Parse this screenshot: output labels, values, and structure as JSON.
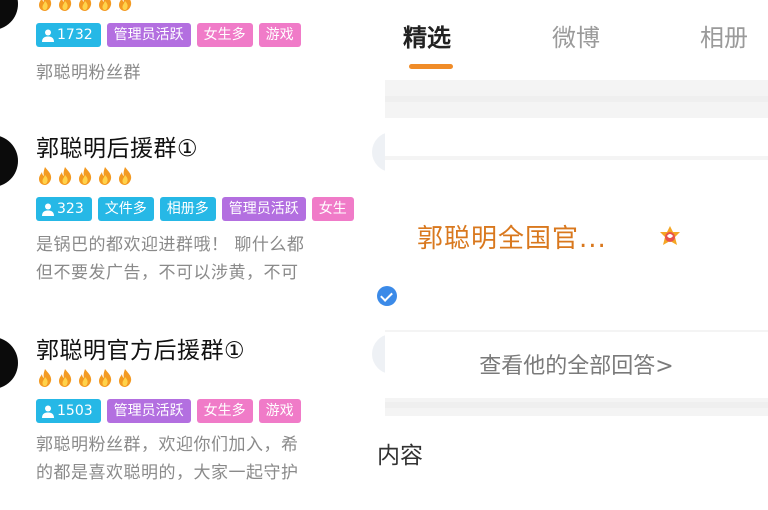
{
  "groups": [
    {
      "title": "",
      "flames": 5,
      "tags": [
        {
          "kind": "members",
          "text": "1732"
        },
        {
          "kind": "purple",
          "text": "管理员活跃"
        },
        {
          "kind": "pink",
          "text": "女生多"
        },
        {
          "kind": "pink",
          "text": "游戏"
        }
      ],
      "desc1": "郭聪明粉丝群",
      "desc2": ""
    },
    {
      "title": "郭聪明后援群①",
      "flames": 5,
      "tags": [
        {
          "kind": "members",
          "text": "323"
        },
        {
          "kind": "blue",
          "text": "文件多"
        },
        {
          "kind": "blue",
          "text": "相册多"
        },
        {
          "kind": "purple",
          "text": "管理员活跃"
        },
        {
          "kind": "pink",
          "text": "女生"
        }
      ],
      "desc1": "是锅巴的都欢迎进群哦！ 聊什么都",
      "desc2": "但不要发广告，不可以涉黄，不可"
    },
    {
      "title": "郭聪明官方后援群①",
      "flames": 5,
      "tags": [
        {
          "kind": "members",
          "text": "1503"
        },
        {
          "kind": "purple",
          "text": "管理员活跃"
        },
        {
          "kind": "pink",
          "text": "女生多"
        },
        {
          "kind": "pink",
          "text": "游戏"
        }
      ],
      "desc1": "郭聪明粉丝群，欢迎你们加入，希",
      "desc2": "的都是喜欢聪明的，大家一起守护"
    }
  ],
  "tabs": [
    {
      "label": "精选",
      "active": true
    },
    {
      "label": "微博",
      "active": false
    },
    {
      "label": "相册",
      "active": false
    }
  ],
  "answer": {
    "title": "郭聪明全国官...",
    "see_all": "查看他的全部回答>"
  },
  "content_label": "内容",
  "colors": {
    "accent_orange": "#f08c28",
    "tag_blue": "#26b8e6",
    "tag_purple": "#b36fe0",
    "tag_pink": "#f07bc8"
  }
}
